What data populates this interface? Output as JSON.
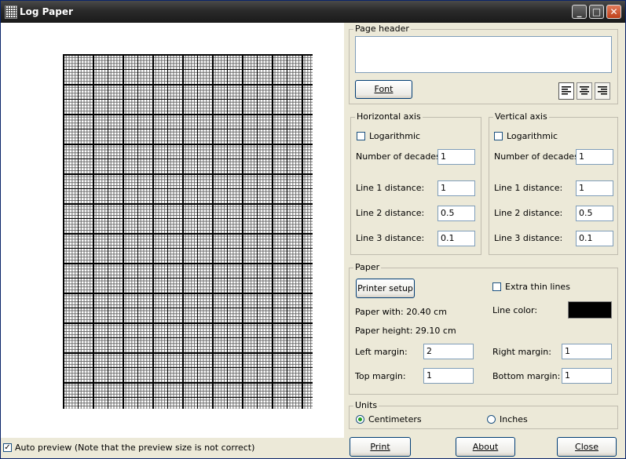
{
  "window": {
    "title": "Log Paper",
    "min_label": "_",
    "max_label": "□",
    "close_label": "✕"
  },
  "preview": {
    "autopreview_label": "Auto preview (Note that the preview size is not correct)",
    "autopreview_checked": true
  },
  "page_header": {
    "legend": "Page header",
    "text": "",
    "font_button": "Font"
  },
  "horizontal_axis": {
    "legend": "Horizontal axis",
    "logarithmic_label": "Logarithmic",
    "logarithmic_checked": false,
    "decades_label": "Number of decades:",
    "decades_value": "1",
    "line1_label": "Line 1 distance:",
    "line1_value": "1",
    "line2_label": "Line 2 distance:",
    "line2_value": "0.5",
    "line3_label": "Line 3 distance:",
    "line3_value": "0.1"
  },
  "vertical_axis": {
    "legend": "Vertical axis",
    "logarithmic_label": "Logarithmic",
    "logarithmic_checked": false,
    "decades_label": "Number of decades:",
    "decades_value": "1",
    "line1_label": "Line 1 distance:",
    "line1_value": "1",
    "line2_label": "Line 2 distance:",
    "line2_value": "0.5",
    "line3_label": "Line 3 distance:",
    "line3_value": "0.1"
  },
  "paper": {
    "legend": "Paper",
    "printer_setup_button": "Printer setup",
    "extra_thin_label": "Extra thin lines",
    "extra_thin_checked": false,
    "paper_width": "Paper with: 20.40 cm",
    "paper_height": "Paper height: 29.10 cm",
    "line_color_label": "Line color:",
    "line_color": "#000000",
    "left_margin_label": "Left margin:",
    "left_margin_value": "2",
    "right_margin_label": "Right margin:",
    "right_margin_value": "1",
    "top_margin_label": "Top margin:",
    "top_margin_value": "1",
    "bottom_margin_label": "Bottom margin:",
    "bottom_margin_value": "1"
  },
  "units": {
    "legend": "Units",
    "centimeters_label": "Centimeters",
    "inches_label": "Inches",
    "selected": "Centimeters"
  },
  "buttons": {
    "print": "Print",
    "about": "About",
    "close": "Close"
  }
}
